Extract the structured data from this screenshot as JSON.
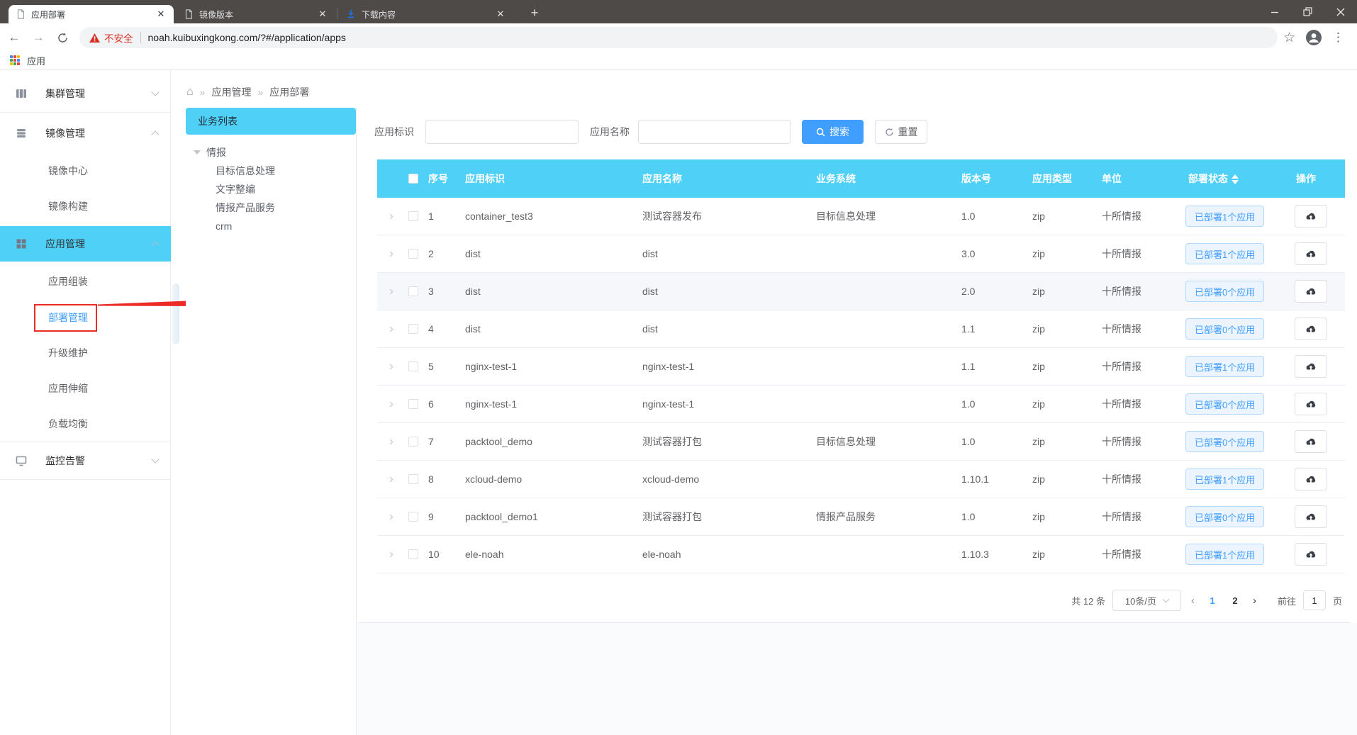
{
  "browser": {
    "tabs": [
      {
        "title": "应用部署",
        "icon": "document"
      },
      {
        "title": "镜像版本",
        "icon": "document"
      },
      {
        "title": "下载内容",
        "icon": "download"
      }
    ],
    "security_warning": "不安全",
    "url": "noah.kuibuxingkong.com/?#/application/apps",
    "bookmark_label": "应用"
  },
  "sidebar": {
    "items": [
      {
        "label": "集群管理"
      },
      {
        "label": "镜像管理",
        "children": [
          "镜像中心",
          "镜像构建"
        ]
      },
      {
        "label": "应用管理",
        "children": [
          "应用组装",
          "部署管理",
          "升级维护",
          "应用伸缩",
          "负载均衡"
        ],
        "active_child": "部署管理"
      },
      {
        "label": "监控告警"
      }
    ]
  },
  "breadcrumb": {
    "items": [
      "应用管理",
      "应用部署"
    ]
  },
  "business_panel": {
    "title": "业务列表",
    "tree": {
      "label": "情报",
      "children": [
        "目标信息处理",
        "文字整编",
        "情报产品服务",
        "crm"
      ]
    }
  },
  "search": {
    "fields": [
      {
        "label": "应用标识",
        "value": ""
      },
      {
        "label": "应用名称",
        "value": ""
      }
    ],
    "search_label": "搜索",
    "reset_label": "重置"
  },
  "table": {
    "headers": [
      "序号",
      "应用标识",
      "应用名称",
      "业务系统",
      "版本号",
      "应用类型",
      "单位",
      "部署状态",
      "操作"
    ],
    "rows": [
      {
        "num": "1",
        "app_id": "container_test3",
        "app_name": "测试容器发布",
        "system": "目标信息处理",
        "version": "1.0",
        "type": "zip",
        "unit": "十所情报",
        "status": "已部署1个应用"
      },
      {
        "num": "2",
        "app_id": "dist",
        "app_name": "dist",
        "system": "",
        "version": "3.0",
        "type": "zip",
        "unit": "十所情报",
        "status": "已部署1个应用"
      },
      {
        "num": "3",
        "app_id": "dist",
        "app_name": "dist",
        "system": "",
        "version": "2.0",
        "type": "zip",
        "unit": "十所情报",
        "status": "已部署0个应用",
        "hover": true
      },
      {
        "num": "4",
        "app_id": "dist",
        "app_name": "dist",
        "system": "",
        "version": "1.1",
        "type": "zip",
        "unit": "十所情报",
        "status": "已部署0个应用"
      },
      {
        "num": "5",
        "app_id": "nginx-test-1",
        "app_name": "nginx-test-1",
        "system": "",
        "version": "1.1",
        "type": "zip",
        "unit": "十所情报",
        "status": "已部署1个应用"
      },
      {
        "num": "6",
        "app_id": "nginx-test-1",
        "app_name": "nginx-test-1",
        "system": "",
        "version": "1.0",
        "type": "zip",
        "unit": "十所情报",
        "status": "已部署0个应用"
      },
      {
        "num": "7",
        "app_id": "packtool_demo",
        "app_name": "测试容器打包",
        "system": "目标信息处理",
        "version": "1.0",
        "type": "zip",
        "unit": "十所情报",
        "status": "已部署0个应用"
      },
      {
        "num": "8",
        "app_id": "xcloud-demo",
        "app_name": "xcloud-demo",
        "system": "",
        "version": "1.10.1",
        "type": "zip",
        "unit": "十所情报",
        "status": "已部署1个应用"
      },
      {
        "num": "9",
        "app_id": "packtool_demo1",
        "app_name": "测试容器打包",
        "system": "情报产品服务",
        "version": "1.0",
        "type": "zip",
        "unit": "十所情报",
        "status": "已部署0个应用"
      },
      {
        "num": "10",
        "app_id": "ele-noah",
        "app_name": "ele-noah",
        "system": "",
        "version": "1.10.3",
        "type": "zip",
        "unit": "十所情报",
        "status": "已部署1个应用"
      }
    ]
  },
  "pagination": {
    "total": "共 12 条",
    "page_size": "10条/页",
    "pages": [
      "1",
      "2"
    ],
    "active_page": "1",
    "goto_label": "前往",
    "goto_value": "1",
    "page_suffix": "页"
  },
  "colors": {
    "accent_cyan": "#4fd0f7",
    "accent_blue": "#409eff",
    "annotation_red": "#ec2b26",
    "warning_red": "#d93025"
  }
}
